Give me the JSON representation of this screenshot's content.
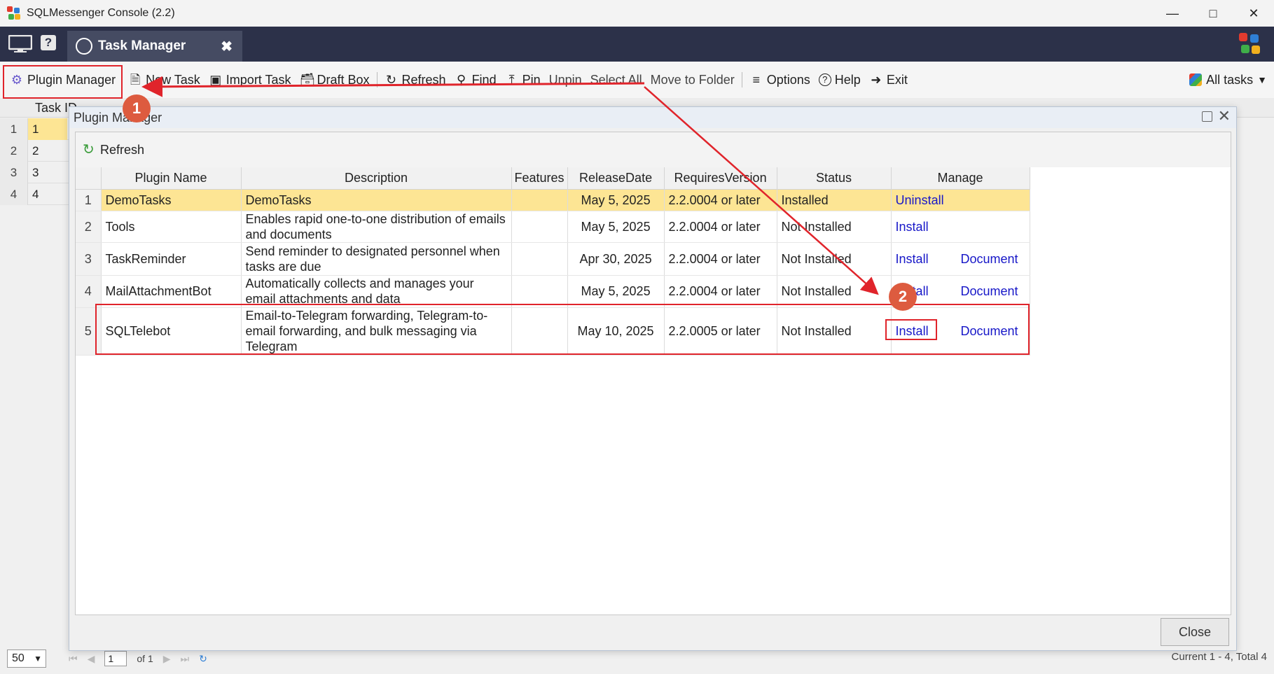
{
  "window": {
    "title": "SQLMessenger Console (2.2)",
    "minimize_icon": "minimize-icon",
    "maximize_icon": "maximize-icon",
    "close_icon": "close-icon"
  },
  "tabbar": {
    "tab_label": "Task Manager",
    "help_glyph": "?",
    "close_glyph": "✖"
  },
  "toolbar": {
    "plugin_manager": "Plugin Manager",
    "new_task": "New Task",
    "import_task": "Import Task",
    "draft_box": "Draft Box",
    "refresh": "Refresh",
    "find": "Find",
    "pin": "Pin",
    "unpin": "Unpin",
    "select_all": "Select All",
    "move_to_folder": "Move to Folder",
    "options": "Options",
    "help": "Help",
    "exit": "Exit",
    "all_tasks": "All tasks"
  },
  "background_grid": {
    "col_task_id": "Task ID",
    "rows": [
      {
        "num": "1",
        "id": "1"
      },
      {
        "num": "2",
        "id": "2"
      },
      {
        "num": "3",
        "id": "3"
      },
      {
        "num": "4",
        "id": "4"
      }
    ]
  },
  "statusbar": {
    "page_size": "50",
    "page_number": "1",
    "of_pages": "of 1",
    "summary": "Current 1 - 4, Total 4"
  },
  "dialog": {
    "title": "Plugin Manager",
    "refresh_label": "Refresh",
    "close_label": "Close",
    "columns": [
      "Plugin Name",
      "Description",
      "Features",
      "ReleaseDate",
      "RequiresVersion",
      "Status",
      "Manage"
    ],
    "rows": [
      {
        "num": "1",
        "name": "DemoTasks",
        "description": "DemoTasks",
        "features": "",
        "release": "May 5, 2025",
        "requires": "2.2.0004 or later",
        "status": "Installed",
        "action": "Uninstall",
        "doc": ""
      },
      {
        "num": "2",
        "name": "Tools",
        "description": "Enables rapid one-to-one distribution of emails and documents",
        "features": "",
        "release": "May 5, 2025",
        "requires": "2.2.0004 or later",
        "status": "Not Installed",
        "action": "Install",
        "doc": ""
      },
      {
        "num": "3",
        "name": "TaskReminder",
        "description": "Send reminder to designated personnel when tasks are due",
        "features": "",
        "release": "Apr 30, 2025",
        "requires": "2.2.0004 or later",
        "status": "Not Installed",
        "action": "Install",
        "doc": "Document"
      },
      {
        "num": "4",
        "name": "MailAttachmentBot",
        "description": "Automatically collects and manages your email attachments and data",
        "features": "",
        "release": "May 5, 2025",
        "requires": "2.2.0004 or later",
        "status": "Not Installed",
        "action": "Install",
        "doc": "Document"
      },
      {
        "num": "5",
        "name": "SQLTelebot",
        "description": "Email-to-Telegram forwarding, Telegram-to-email forwarding, and bulk messaging via Telegram",
        "features": "",
        "release": "May 10, 2025",
        "requires": "2.2.0005 or later",
        "status": "Not Installed",
        "action": "Install",
        "doc": "Document"
      }
    ]
  },
  "annotations": {
    "badge_1": "1",
    "badge_2": "2",
    "color": "#e0242b"
  }
}
